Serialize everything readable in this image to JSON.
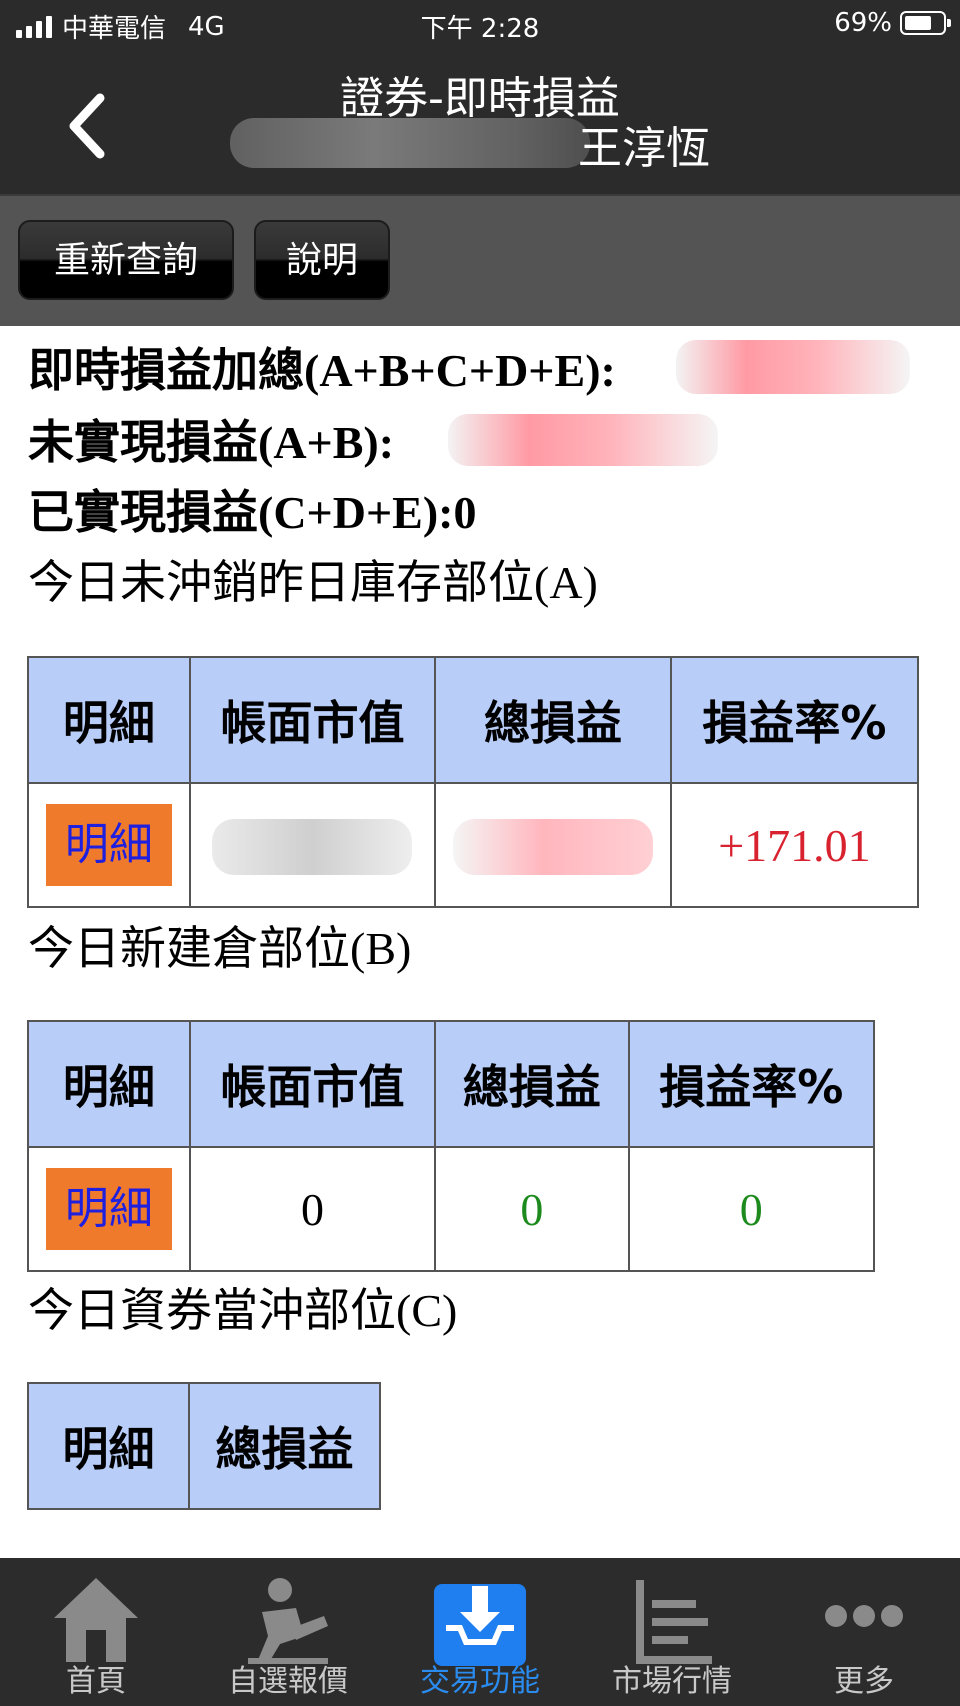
{
  "status_bar": {
    "carrier": "中華電信",
    "network": "4G",
    "time": "下午 2:28",
    "battery": "69%"
  },
  "nav": {
    "title": "證券-即時損益",
    "account_name": "王淳恆"
  },
  "toolbar": {
    "requery_label": "重新查詢",
    "help_label": "說明"
  },
  "summary": {
    "total_label": "即時損益加總(A+B+C+D+E):",
    "unrealized_label": "未實現損益(A+B):",
    "realized_label": "已實現損益(C+D+E):0"
  },
  "section_a": {
    "title": "今日未沖銷昨日庫存部位(A)",
    "headers": [
      "明細",
      "帳面市值",
      "總損益",
      "損益率%"
    ],
    "detail_label": "明細",
    "rate": "+171.01"
  },
  "section_b": {
    "title": "今日新建倉部位(B)",
    "headers": [
      "明細",
      "帳面市值",
      "總損益",
      "損益率%"
    ],
    "detail_label": "明細",
    "market_value": "0",
    "total_pl": "0",
    "rate": "0"
  },
  "section_c": {
    "title": "今日資券當沖部位(C)",
    "headers": [
      "明細",
      "總損益"
    ]
  },
  "tabs": [
    {
      "label": "首頁",
      "icon": "home-icon",
      "active": false
    },
    {
      "label": "自選報價",
      "icon": "person-quote-icon",
      "active": false
    },
    {
      "label": "交易功能",
      "icon": "trade-download-icon",
      "active": true
    },
    {
      "label": "市場行情",
      "icon": "market-list-icon",
      "active": false
    },
    {
      "label": "更多",
      "icon": "more-dots-icon",
      "active": false
    }
  ],
  "colors": {
    "header_bg": "#2b2b2b",
    "table_header": "#b8cdf8",
    "detail_btn": "#f07a2c",
    "active_tab": "#2b8cf0",
    "gain_red": "#d9222f",
    "zero_green": "#1d8a1d"
  }
}
